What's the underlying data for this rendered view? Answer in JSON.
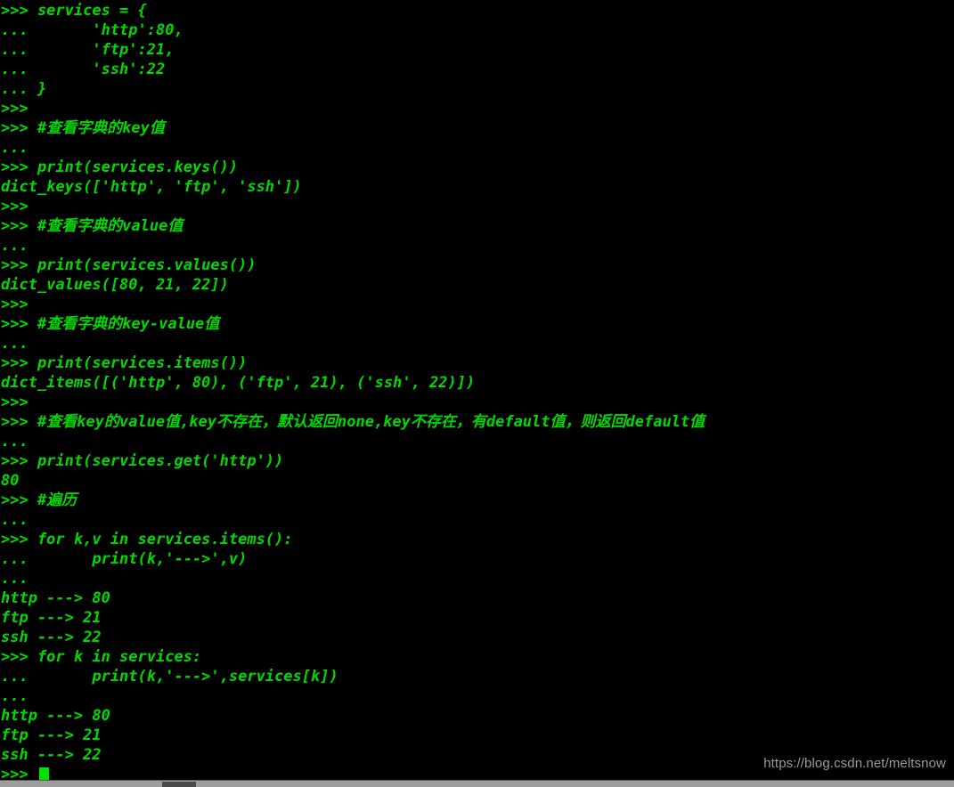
{
  "terminal": {
    "prompt_primary": ">>> ",
    "prompt_continuation": "... ",
    "cursor": "block-cursor",
    "colors": {
      "background": "#000000",
      "foreground": "#00d900",
      "cursor": "#00e000",
      "watermark": "#9a9a9a",
      "bottom_bar": "#9d9d9d",
      "scrollbar_thumb": "#4a4a4a"
    },
    "lines": [
      ">>> services = {",
      "...       'http':80,",
      "...       'ftp':21,",
      "...       'ssh':22",
      "... }",
      ">>>",
      ">>> #查看字典的key值",
      "...",
      ">>> print(services.keys())",
      "dict_keys(['http', 'ftp', 'ssh'])",
      ">>>",
      ">>> #查看字典的value值",
      "...",
      ">>> print(services.values())",
      "dict_values([80, 21, 22])",
      ">>>",
      ">>> #查看字典的key-value值",
      "...",
      ">>> print(services.items())",
      "dict_items([('http', 80), ('ftp', 21), ('ssh', 22)])",
      ">>>",
      ">>> #查看key的value值,key不存在，默认返回none,key不存在，有default值，则返回default值",
      "...",
      ">>> print(services.get('http'))",
      "80",
      ">>> #遍历",
      "...",
      ">>> for k,v in services.items():",
      "...       print(k,'--->',v)",
      "...",
      "http ---> 80",
      "ftp ---> 21",
      "ssh ---> 22",
      ">>> for k in services:",
      "...       print(k,'--->',services[k])",
      "...",
      "http ---> 80",
      "ftp ---> 21",
      "ssh ---> 22"
    ],
    "last_line_prompt": ">>> "
  },
  "watermark": {
    "text": "https://blog.csdn.net/meltsnow"
  }
}
